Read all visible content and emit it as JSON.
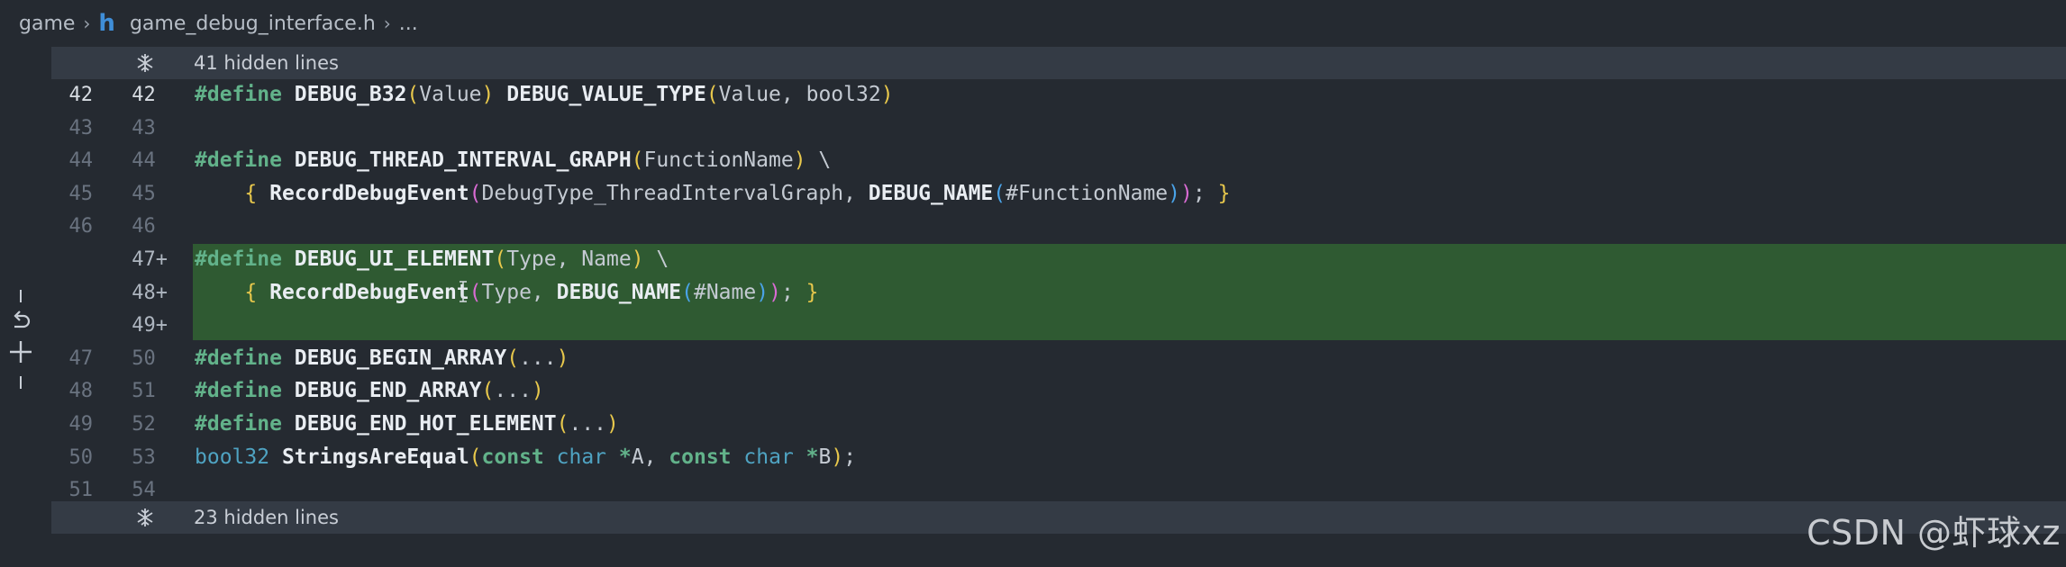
{
  "breadcrumb": {
    "root": "game",
    "file_icon": "h",
    "file": "game_debug_interface.h",
    "more": "..."
  },
  "hidden_top": {
    "label": "41 hidden lines"
  },
  "hidden_bottom": {
    "label": "23 hidden lines"
  },
  "lines": [
    {
      "old": "42",
      "new": "42",
      "tokens": [
        [
          "kw",
          "#define"
        ],
        [
          "txt",
          " "
        ],
        [
          "id",
          "DEBUG_B32"
        ],
        [
          "p1",
          "("
        ],
        [
          "txt",
          "Value"
        ],
        [
          "p1",
          ")"
        ],
        [
          "txt",
          " "
        ],
        [
          "id",
          "DEBUG_VALUE_TYPE"
        ],
        [
          "p1",
          "("
        ],
        [
          "txt",
          "Value, bool32"
        ],
        [
          "p1",
          ")"
        ]
      ]
    },
    {
      "old": "43",
      "new": "43",
      "tokens": []
    },
    {
      "old": "44",
      "new": "44",
      "tokens": [
        [
          "kw",
          "#define"
        ],
        [
          "txt",
          " "
        ],
        [
          "id",
          "DEBUG_THREAD_INTERVAL_GRAPH"
        ],
        [
          "p1",
          "("
        ],
        [
          "txt",
          "FunctionName"
        ],
        [
          "p1",
          ")"
        ],
        [
          "txt",
          " \\"
        ]
      ]
    },
    {
      "old": "45",
      "new": "45",
      "tokens": [
        [
          "txt",
          "    "
        ],
        [
          "p1",
          "{"
        ],
        [
          "txt",
          " "
        ],
        [
          "id",
          "RecordDebugEvent"
        ],
        [
          "p2",
          "("
        ],
        [
          "txt",
          "DebugType_ThreadIntervalGraph, "
        ],
        [
          "id",
          "DEBUG_NAME"
        ],
        [
          "p3",
          "("
        ],
        [
          "txt",
          "#FunctionName"
        ],
        [
          "p3",
          ")"
        ],
        [
          "p2",
          ")"
        ],
        [
          "txt",
          "; "
        ],
        [
          "p1",
          "}"
        ]
      ]
    },
    {
      "old": "46",
      "new": "46",
      "tokens": []
    },
    {
      "old": "",
      "new": "47",
      "added": true,
      "tokens": [
        [
          "kw",
          "#define"
        ],
        [
          "txt",
          " "
        ],
        [
          "id",
          "DEBUG_UI_ELEMENT"
        ],
        [
          "p1",
          "("
        ],
        [
          "txt",
          "Type, Name"
        ],
        [
          "p1",
          ")"
        ],
        [
          "txt",
          " \\"
        ]
      ]
    },
    {
      "old": "",
      "new": "48",
      "added": true,
      "tokens": [
        [
          "txt",
          "    "
        ],
        [
          "p1",
          "{"
        ],
        [
          "txt",
          " "
        ],
        [
          "id",
          "RecordDebugEvent"
        ],
        [
          "p2",
          "("
        ],
        [
          "txt",
          "Type, "
        ],
        [
          "id",
          "DEBUG_NAME"
        ],
        [
          "p3",
          "("
        ],
        [
          "txt",
          "#Name"
        ],
        [
          "p3",
          ")"
        ],
        [
          "p2",
          ")"
        ],
        [
          "txt",
          "; "
        ],
        [
          "p1",
          "}"
        ]
      ]
    },
    {
      "old": "",
      "new": "49",
      "added": true,
      "tokens": []
    },
    {
      "old": "47",
      "new": "50",
      "tokens": [
        [
          "kw",
          "#define"
        ],
        [
          "txt",
          " "
        ],
        [
          "id",
          "DEBUG_BEGIN_ARRAY"
        ],
        [
          "p1",
          "("
        ],
        [
          "txt",
          "..."
        ],
        [
          "p1",
          ")"
        ]
      ]
    },
    {
      "old": "48",
      "new": "51",
      "tokens": [
        [
          "kw",
          "#define"
        ],
        [
          "txt",
          " "
        ],
        [
          "id",
          "DEBUG_END_ARRAY"
        ],
        [
          "p1",
          "("
        ],
        [
          "txt",
          "..."
        ],
        [
          "p1",
          ")"
        ]
      ]
    },
    {
      "old": "49",
      "new": "52",
      "tokens": [
        [
          "kw",
          "#define"
        ],
        [
          "txt",
          " "
        ],
        [
          "id",
          "DEBUG_END_HOT_ELEMENT"
        ],
        [
          "p1",
          "("
        ],
        [
          "txt",
          "..."
        ],
        [
          "p1",
          ")"
        ]
      ]
    },
    {
      "old": "50",
      "new": "53",
      "tokens": [
        [
          "ty",
          "bool32"
        ],
        [
          "txt",
          " "
        ],
        [
          "id",
          "StringsAreEqual"
        ],
        [
          "p1",
          "("
        ],
        [
          "kw",
          "const"
        ],
        [
          "txt",
          " "
        ],
        [
          "ty",
          "char"
        ],
        [
          "txt",
          " "
        ],
        [
          "kw",
          "*"
        ],
        [
          "txt",
          "A, "
        ],
        [
          "kw",
          "const"
        ],
        [
          "txt",
          " "
        ],
        [
          "ty",
          "char"
        ],
        [
          "txt",
          " "
        ],
        [
          "kw",
          "*"
        ],
        [
          "txt",
          "B"
        ],
        [
          "p1",
          ")"
        ],
        [
          "txt",
          ";"
        ]
      ]
    },
    {
      "old": "51",
      "new": "54",
      "tokens": []
    }
  ],
  "plus_sign": "+",
  "icons": {
    "unfold": "unfold-icon",
    "revert": "revert-icon",
    "stage": "stage-plus-icon",
    "file": "c-header-file-icon"
  },
  "colors": {
    "added_bg": "#2f5a32",
    "keyword": "#62b28a",
    "identifier": "#e9edf2",
    "bracket_1": "#e8c84c",
    "bracket_2": "#d96bd3",
    "bracket_3": "#4aa3e8"
  },
  "watermark": "CSDN @虾球xz"
}
